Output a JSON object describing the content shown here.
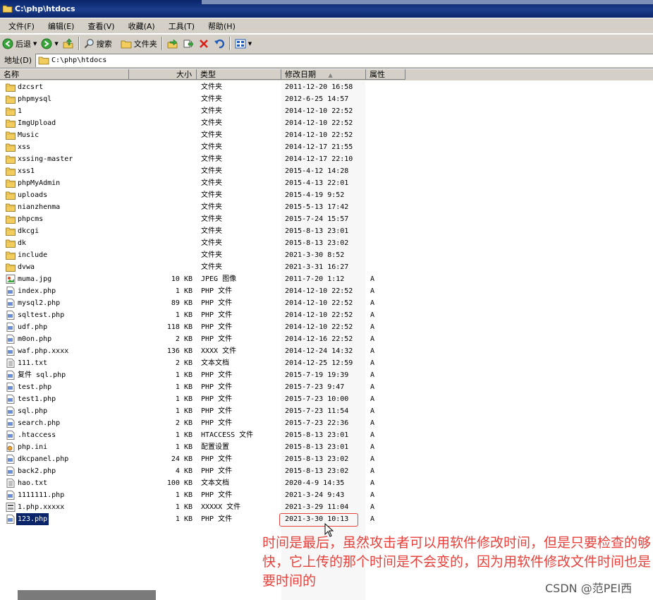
{
  "window": {
    "title": "C:\\php\\htdocs"
  },
  "menu": [
    "文件(F)",
    "编辑(E)",
    "查看(V)",
    "收藏(A)",
    "工具(T)",
    "帮助(H)"
  ],
  "toolbar": {
    "back_label": "后退",
    "search_label": "搜索",
    "folders_label": "文件夹"
  },
  "address": {
    "label": "地址(D)",
    "value": "C:\\php\\htdocs"
  },
  "columns": {
    "name": "名称",
    "size": "大小",
    "type": "类型",
    "modified": "修改日期",
    "attributes": "属性"
  },
  "files": [
    {
      "name": "dzcsrt",
      "size": "",
      "type": "文件夹",
      "modified": "2011-12-20 16:58",
      "attr": "",
      "icon": "folder"
    },
    {
      "name": "phpmysql",
      "size": "",
      "type": "文件夹",
      "modified": "2012-6-25 14:57",
      "attr": "",
      "icon": "folder"
    },
    {
      "name": "1",
      "size": "",
      "type": "文件夹",
      "modified": "2014-12-10 22:52",
      "attr": "",
      "icon": "folder"
    },
    {
      "name": "ImgUpload",
      "size": "",
      "type": "文件夹",
      "modified": "2014-12-10 22:52",
      "attr": "",
      "icon": "folder"
    },
    {
      "name": "Music",
      "size": "",
      "type": "文件夹",
      "modified": "2014-12-10 22:52",
      "attr": "",
      "icon": "folder"
    },
    {
      "name": "xss",
      "size": "",
      "type": "文件夹",
      "modified": "2014-12-17 21:55",
      "attr": "",
      "icon": "folder"
    },
    {
      "name": "xssing-master",
      "size": "",
      "type": "文件夹",
      "modified": "2014-12-17 22:10",
      "attr": "",
      "icon": "folder"
    },
    {
      "name": "xss1",
      "size": "",
      "type": "文件夹",
      "modified": "2015-4-12 14:28",
      "attr": "",
      "icon": "folder"
    },
    {
      "name": "phpMyAdmin",
      "size": "",
      "type": "文件夹",
      "modified": "2015-4-13 22:01",
      "attr": "",
      "icon": "folder"
    },
    {
      "name": "uploads",
      "size": "",
      "type": "文件夹",
      "modified": "2015-4-19 9:52",
      "attr": "",
      "icon": "folder"
    },
    {
      "name": "nianzhenma",
      "size": "",
      "type": "文件夹",
      "modified": "2015-5-13 17:42",
      "attr": "",
      "icon": "folder"
    },
    {
      "name": "phpcms",
      "size": "",
      "type": "文件夹",
      "modified": "2015-7-24 15:57",
      "attr": "",
      "icon": "folder"
    },
    {
      "name": "dkcgi",
      "size": "",
      "type": "文件夹",
      "modified": "2015-8-13 23:01",
      "attr": "",
      "icon": "folder"
    },
    {
      "name": "dk",
      "size": "",
      "type": "文件夹",
      "modified": "2015-8-13 23:02",
      "attr": "",
      "icon": "folder"
    },
    {
      "name": "include",
      "size": "",
      "type": "文件夹",
      "modified": "2021-3-30 8:52",
      "attr": "",
      "icon": "folder"
    },
    {
      "name": "dvwa",
      "size": "",
      "type": "文件夹",
      "modified": "2021-3-31 16:27",
      "attr": "",
      "icon": "folder"
    },
    {
      "name": "muma.jpg",
      "size": "10 KB",
      "type": "JPEG 图像",
      "modified": "2011-7-20 1:12",
      "attr": "A",
      "icon": "image"
    },
    {
      "name": "index.php",
      "size": "1 KB",
      "type": "PHP 文件",
      "modified": "2014-12-10 22:52",
      "attr": "A",
      "icon": "file"
    },
    {
      "name": "mysql2.php",
      "size": "89 KB",
      "type": "PHP 文件",
      "modified": "2014-12-10 22:52",
      "attr": "A",
      "icon": "file"
    },
    {
      "name": "sqltest.php",
      "size": "1 KB",
      "type": "PHP 文件",
      "modified": "2014-12-10 22:52",
      "attr": "A",
      "icon": "file"
    },
    {
      "name": "udf.php",
      "size": "118 KB",
      "type": "PHP 文件",
      "modified": "2014-12-10 22:52",
      "attr": "A",
      "icon": "file"
    },
    {
      "name": "m0on.php",
      "size": "2 KB",
      "type": "PHP 文件",
      "modified": "2014-12-16 22:52",
      "attr": "A",
      "icon": "file"
    },
    {
      "name": "waf.php.xxxx",
      "size": "136 KB",
      "type": "XXXX 文件",
      "modified": "2014-12-24 14:32",
      "attr": "A",
      "icon": "file"
    },
    {
      "name": "111.txt",
      "size": "2 KB",
      "type": "文本文档",
      "modified": "2014-12-25 12:59",
      "attr": "A",
      "icon": "text"
    },
    {
      "name": "复件 sql.php",
      "size": "1 KB",
      "type": "PHP 文件",
      "modified": "2015-7-19 19:39",
      "attr": "A",
      "icon": "file"
    },
    {
      "name": "test.php",
      "size": "1 KB",
      "type": "PHP 文件",
      "modified": "2015-7-23 9:47",
      "attr": "A",
      "icon": "file"
    },
    {
      "name": "test1.php",
      "size": "1 KB",
      "type": "PHP 文件",
      "modified": "2015-7-23 10:00",
      "attr": "A",
      "icon": "file"
    },
    {
      "name": "sql.php",
      "size": "1 KB",
      "type": "PHP 文件",
      "modified": "2015-7-23 11:54",
      "attr": "A",
      "icon": "file"
    },
    {
      "name": "search.php",
      "size": "2 KB",
      "type": "PHP 文件",
      "modified": "2015-7-23 22:36",
      "attr": "A",
      "icon": "file"
    },
    {
      "name": ".htaccess",
      "size": "1 KB",
      "type": "HTACCESS 文件",
      "modified": "2015-8-13 23:01",
      "attr": "A",
      "icon": "file"
    },
    {
      "name": "php.ini",
      "size": "1 KB",
      "type": "配置设置",
      "modified": "2015-8-13 23:01",
      "attr": "A",
      "icon": "config"
    },
    {
      "name": "dkcpanel.php",
      "size": "24 KB",
      "type": "PHP 文件",
      "modified": "2015-8-13 23:02",
      "attr": "A",
      "icon": "file"
    },
    {
      "name": "back2.php",
      "size": "4 KB",
      "type": "PHP 文件",
      "modified": "2015-8-13 23:02",
      "attr": "A",
      "icon": "file"
    },
    {
      "name": "hao.txt",
      "size": "100 KB",
      "type": "文本文档",
      "modified": "2020-4-9 14:35",
      "attr": "A",
      "icon": "text"
    },
    {
      "name": "1111111.php",
      "size": "1 KB",
      "type": "PHP 文件",
      "modified": "2021-3-24 9:43",
      "attr": "A",
      "icon": "file"
    },
    {
      "name": "1.php.xxxxx",
      "size": "1 KB",
      "type": "XXXXX 文件",
      "modified": "2021-3-29 11:04",
      "attr": "A",
      "icon": "blank"
    },
    {
      "name": "123.php",
      "size": "1 KB",
      "type": "PHP 文件",
      "modified": "2021-3-30 10:13",
      "attr": "A",
      "icon": "file",
      "selected": true
    }
  ],
  "annotation": {
    "text": "时间是最后，虽然攻击者可以用软件修改时间，但是只要检查的够快，它上传的那个时间是不会变的，因为用软件修改文件时间也是要时间的",
    "color": "#e8403a"
  },
  "watermark": "CSDN @范PEI西",
  "colors": {
    "titlebar": "#0a246a",
    "chrome": "#d4d0c8",
    "selection": "#0a246a"
  }
}
